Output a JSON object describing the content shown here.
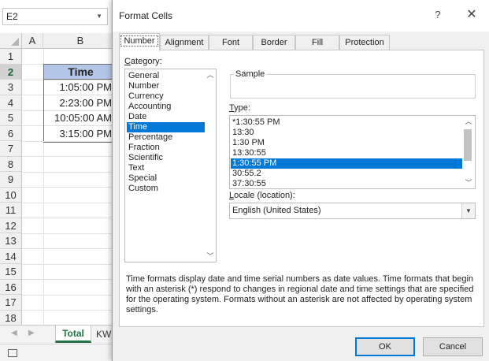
{
  "excel": {
    "name_box": "E2",
    "columns": [
      "A",
      "B"
    ],
    "rows": [
      "1",
      "2",
      "3",
      "4",
      "5",
      "6",
      "7",
      "8",
      "9",
      "10",
      "11",
      "12",
      "13",
      "14",
      "15",
      "16",
      "17",
      "18"
    ],
    "header_cell": "Time",
    "times": [
      "1:05:00 PM",
      "2:23:00 PM",
      "10:05:00 AM",
      "3:15:00 PM"
    ],
    "sheet_tabs": [
      "Total",
      "KW"
    ]
  },
  "dialog": {
    "title": "Format Cells",
    "help": "?",
    "close": "✕",
    "tabs": [
      "Number",
      "Alignment",
      "Font",
      "Border",
      "Fill",
      "Protection"
    ],
    "category_label": "Category:",
    "categories": [
      "General",
      "Number",
      "Currency",
      "Accounting",
      "Date",
      "Time",
      "Percentage",
      "Fraction",
      "Scientific",
      "Text",
      "Special",
      "Custom"
    ],
    "selected_category": "Time",
    "sample_label": "Sample",
    "type_label": "Type:",
    "types": [
      "*1:30:55 PM",
      "13:30",
      "1:30 PM",
      "13:30:55",
      "1:30:55 PM",
      "30:55.2",
      "37:30:55"
    ],
    "selected_type": "1:30:55 PM",
    "locale_label": "Locale (location):",
    "locale_value": "English (United States)",
    "description": "Time formats display date and time serial numbers as date values.  Time formats that begin with an asterisk (*) respond to changes in regional date and time settings that are specified for the operating system. Formats without an asterisk are not affected by operating system settings.",
    "ok": "OK",
    "cancel": "Cancel"
  }
}
